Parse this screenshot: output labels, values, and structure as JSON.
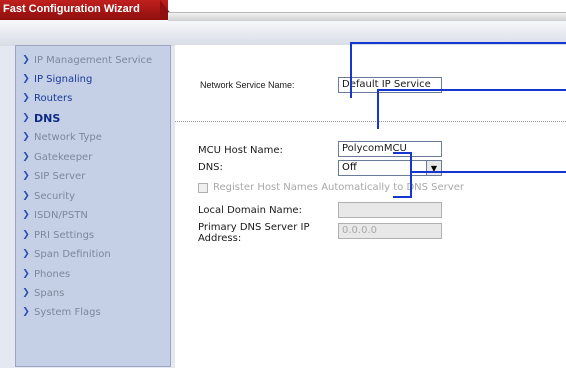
{
  "window": {
    "title": "Fast Configuration Wizard"
  },
  "sidebar": {
    "items": [
      {
        "label": "IP Management Service",
        "state": "dim"
      },
      {
        "label": "IP Signaling",
        "state": "active"
      },
      {
        "label": "Routers",
        "state": "active"
      },
      {
        "label": "DNS",
        "state": "current"
      },
      {
        "label": "Network Type",
        "state": "dim"
      },
      {
        "label": "Gatekeeper",
        "state": "dim"
      },
      {
        "label": "SIP Server",
        "state": "dim"
      },
      {
        "label": "Security",
        "state": "dim"
      },
      {
        "label": "ISDN/PSTN",
        "state": "dim"
      },
      {
        "label": "PRI Settings",
        "state": "dim"
      },
      {
        "label": "Span Definition",
        "state": "dim"
      },
      {
        "label": "Phones",
        "state": "dim"
      },
      {
        "label": "Spans",
        "state": "dim"
      },
      {
        "label": "System Flags",
        "state": "dim"
      }
    ]
  },
  "form": {
    "network_service_name_label": "Network Service Name:",
    "network_service_name_value": "Default IP Service",
    "mcu_host_name_label": "MCU Host Name:",
    "mcu_host_name_value": "PolycomMCU",
    "dns_label": "DNS:",
    "dns_value": "Off",
    "register_checkbox_label": "Register Host Names Automatically to DNS Server",
    "local_domain_label": "Local Domain Name:",
    "local_domain_value": "",
    "primary_dns_label": "Primary DNS Server IP Address:",
    "primary_dns_value": "0.0.0.0"
  },
  "colors": {
    "title_red": "#b01a18",
    "sidebar_bg": "#c5d0e6",
    "callout_blue": "#1536d1"
  }
}
